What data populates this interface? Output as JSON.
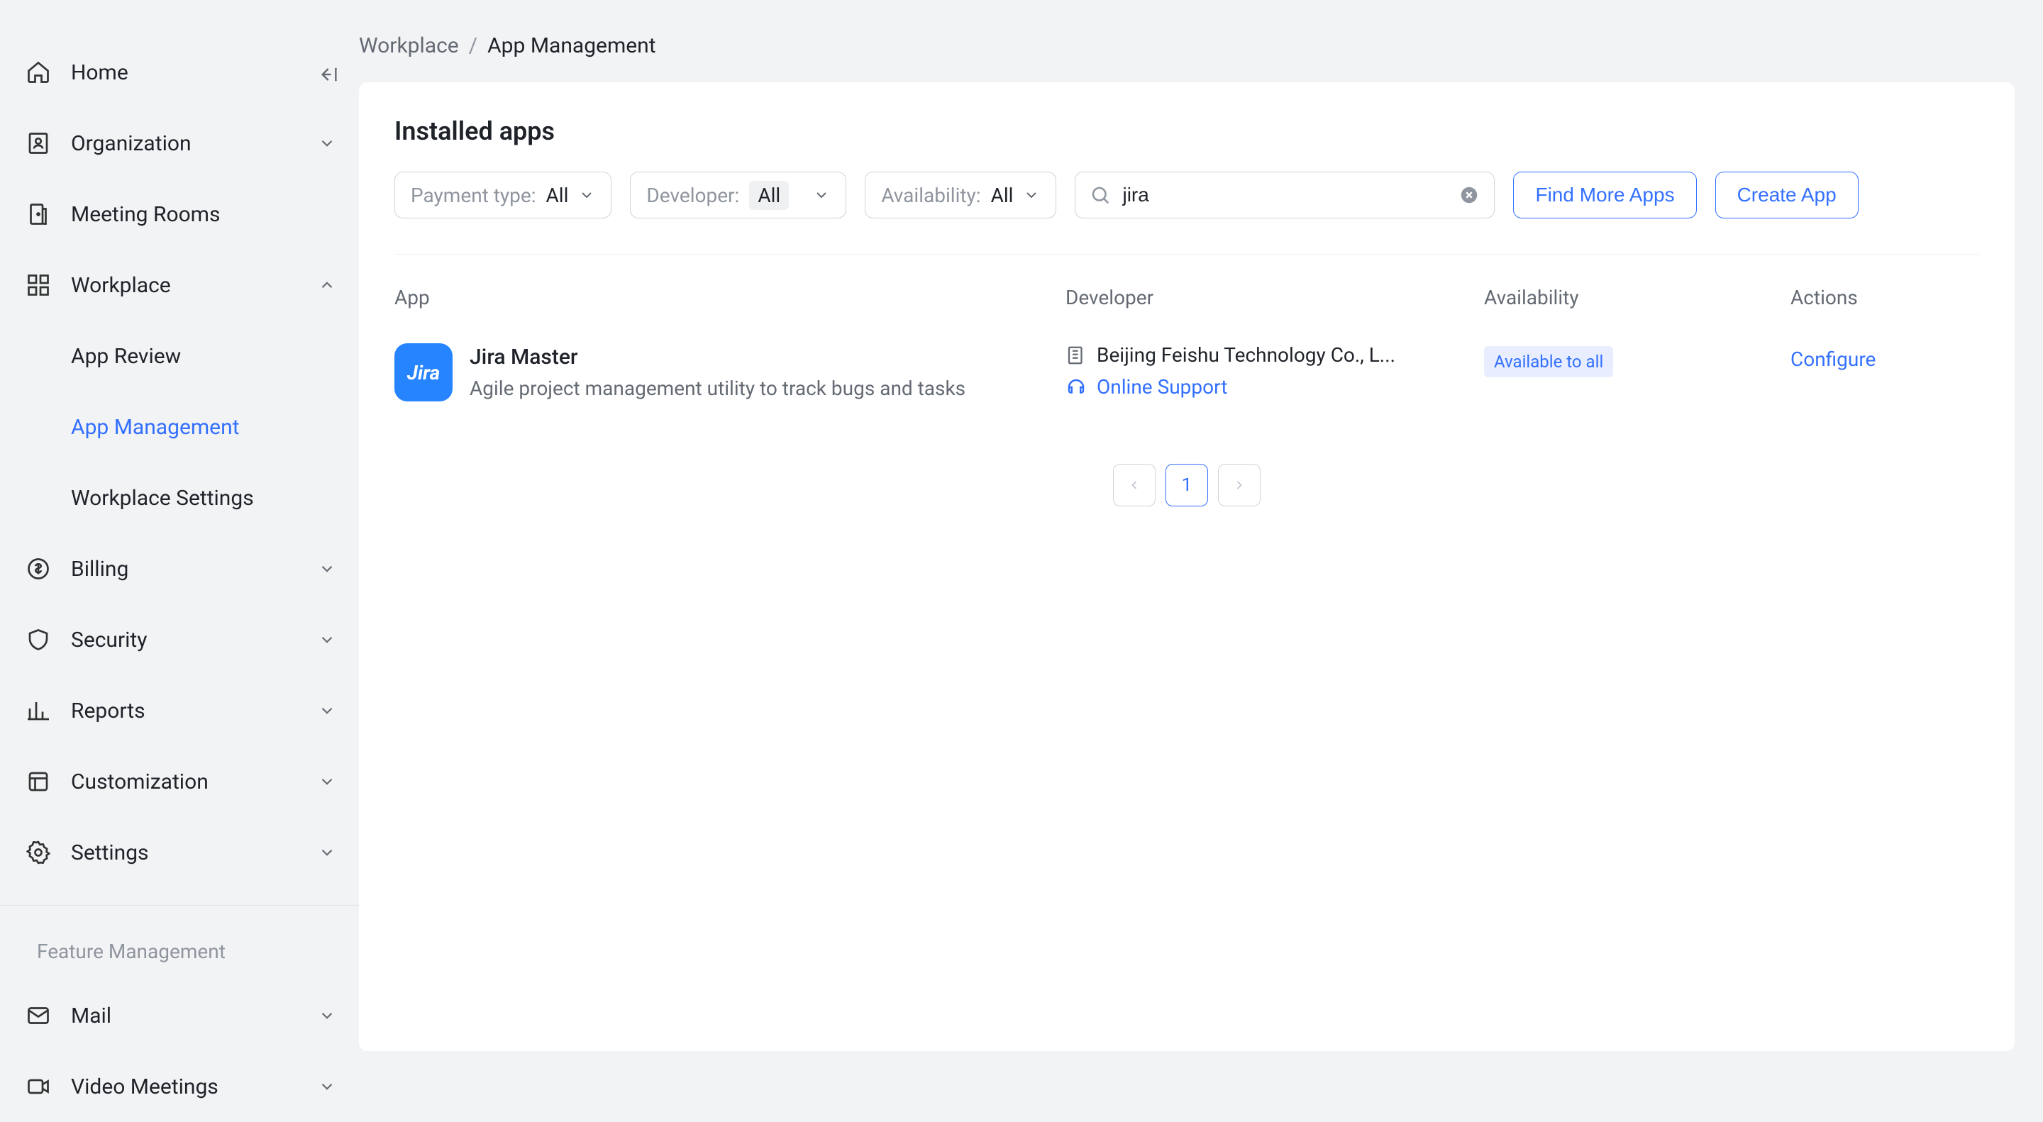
{
  "sidebar": {
    "home": "Home",
    "organization": "Organization",
    "meeting_rooms": "Meeting Rooms",
    "workplace": "Workplace",
    "app_review": "App Review",
    "app_management": "App Management",
    "workplace_settings": "Workplace Settings",
    "billing": "Billing",
    "security": "Security",
    "reports": "Reports",
    "customization": "Customization",
    "settings": "Settings",
    "feature_management": "Feature Management",
    "mail": "Mail",
    "video_meetings": "Video Meetings"
  },
  "breadcrumb": {
    "parent": "Workplace",
    "sep": "/",
    "current": "App Management"
  },
  "page_title": "Installed apps",
  "filters": {
    "payment_label": "Payment type:",
    "payment_value": "All",
    "developer_label": "Developer:",
    "developer_value": "All",
    "availability_label": "Availability:",
    "availability_value": "All"
  },
  "search": {
    "value": "jira"
  },
  "actions": {
    "find_more": "Find More Apps",
    "create_app": "Create App"
  },
  "table": {
    "headers": {
      "app": "App",
      "developer": "Developer",
      "availability": "Availability",
      "actions": "Actions"
    },
    "rows": [
      {
        "icon_text": "Jira",
        "name": "Jira Master",
        "desc": "Agile project management utility to track bugs and tasks",
        "developer": "Beijing Feishu Technology Co., L...",
        "support": "Online Support",
        "availability": "Available to all",
        "action": "Configure"
      }
    ]
  },
  "pagination": {
    "current": "1"
  }
}
